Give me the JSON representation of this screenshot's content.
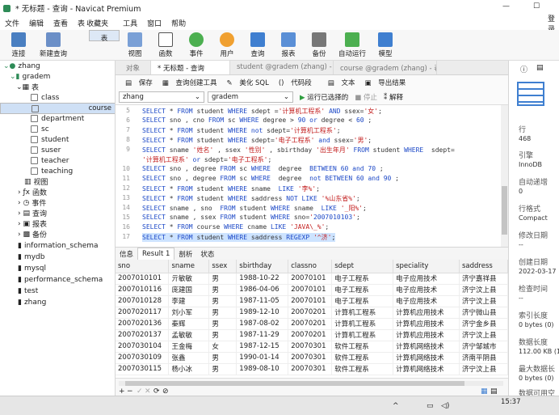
{
  "window": {
    "title": "* 无标题 - 查询 - Navicat Premium",
    "minimize": "—",
    "maximize": "☐"
  },
  "menu": {
    "items": [
      "文件",
      "编辑",
      "查看",
      "表",
      "收藏夹",
      "工具",
      "窗口",
      "帮助"
    ],
    "login": "登录"
  },
  "toolbar": {
    "items": [
      "连接",
      "新建查询",
      "表",
      "视图",
      "函数",
      "事件",
      "用户",
      "查询",
      "报表",
      "备份",
      "自动运行",
      "模型"
    ],
    "selected": "表"
  },
  "tree": {
    "connection": "zhang",
    "db": "gradem",
    "tables_group": "表",
    "tables": [
      "class",
      "course",
      "department",
      "sc",
      "student",
      "suser",
      "teacher",
      "teaching"
    ],
    "selected_table": "course",
    "groups": [
      "视图",
      "函数",
      "事件",
      "查询",
      "报表",
      "备份"
    ],
    "other_dbs": [
      "information_schema",
      "mydb",
      "mysql",
      "performance_schema",
      "test",
      "zhang"
    ]
  },
  "tabs": {
    "objects": "对象",
    "query": "* 无标题 - 查询",
    "t1": "student @gradem (zhang) - ...",
    "t2": "course @gradem (zhang) - 表"
  },
  "qtool": {
    "save": "保存",
    "builder": "查询创建工具",
    "beautify": "美化 SQL",
    "snippet": "代码段",
    "text": "文本",
    "export": "导出结果"
  },
  "selectors": {
    "conn": "zhang",
    "db": "gradem",
    "run": "运行已选择的",
    "stop": "停止",
    "explain": "解释"
  },
  "editor": {
    "lines": [
      {
        "n": "5",
        "t": "SELECT * FROM student WHERE sdept ='计算机工程系' AND ssex='女';"
      },
      {
        "n": "6",
        "t": "SELECT sno , cno FROM sc WHERE degree > 90 or degree < 60 ;"
      },
      {
        "n": "7",
        "t": "SELECT * FROM student WHERE not sdept='计算机工程系';"
      },
      {
        "n": "8",
        "t": "SELECT * FROM student WHERE sdept='电子工程系' and ssex='男';"
      },
      {
        "n": "9",
        "t": "SELECT sname '姓名' , ssex '性别' , sbirthday '出生年月' FROM student WHERE  sdept="
      },
      {
        "n": "",
        "t": "'计算机工程系' or sdept='电子工程系';"
      },
      {
        "n": "10",
        "t": "SELECT sno , degree FROM sc WHERE  degree  BETWEEN 60 and 70 ;"
      },
      {
        "n": "11",
        "t": "SELECT sno , degree FROM sc WHERE  degree  not BETWEEN 60 and 90 ;"
      },
      {
        "n": "12",
        "t": "SELECT * FROM student WHERE sname  LIKE '李%';"
      },
      {
        "n": "13",
        "t": "SELECT * FROM student WHERE saddress NOT LIKE '%山东省%';"
      },
      {
        "n": "14",
        "t": "SELECT sname , sno  FROM student WHERE sname  LIKE '_阳%';"
      },
      {
        "n": "15",
        "t": "SELECT sname , ssex FROM student WHERE sno='2007010103';"
      },
      {
        "n": "16",
        "t": "SELECT * FROM course WHERE cname LIKE 'JAVA\\_%';"
      },
      {
        "n": "17",
        "t": "SELECT * FROM student WHERE saddress REGEXP '^济';"
      }
    ]
  },
  "result_tabs": [
    "信息",
    "Result 1",
    "剖析",
    "状态"
  ],
  "result": {
    "columns": [
      "sno",
      "sname",
      "ssex",
      "sbirthday",
      "classno",
      "sdept",
      "speciality",
      "saddress"
    ],
    "rows": [
      [
        "2007010101",
        "亓敏敏",
        "男",
        "1988-10-22",
        "20070101",
        "电子工程系",
        "电子应用技术",
        "济宁嘉祥县"
      ],
      [
        "2007010116",
        "庞建国",
        "男",
        "1986-04-06",
        "20070101",
        "电子工程系",
        "电子应用技术",
        "济宁汶上县"
      ],
      [
        "2007010128",
        "李建",
        "男",
        "1987-11-05",
        "20070101",
        "电子工程系",
        "电子应用技术",
        "济宁汶上县"
      ],
      [
        "2007020117",
        "刘小军",
        "男",
        "1989-12-10",
        "20070201",
        "计算机工程系",
        "计算机应用技术",
        "济宁微山县"
      ],
      [
        "2007020136",
        "秦辉",
        "男",
        "1987-08-02",
        "20070201",
        "计算机工程系",
        "计算机应用技术",
        "济宁金乡县"
      ],
      [
        "2007020137",
        "孟敏敏",
        "男",
        "1987-11-29",
        "20070201",
        "计算机工程系",
        "计算机应用技术",
        "济宁汶上县"
      ],
      [
        "2007030104",
        "王金梅",
        "女",
        "1987-12-15",
        "20070301",
        "软件工程系",
        "计算机网络技术",
        "济宁邹城市"
      ],
      [
        "2007030109",
        "张鑫",
        "男",
        "1990-01-14",
        "20070301",
        "软件工程系",
        "计算机网络技术",
        "济南平阴县"
      ],
      [
        "2007030115",
        "杨小冰",
        "男",
        "1989-08-10",
        "20070301",
        "软件工程系",
        "计算机网络技术",
        "济宁汶上县"
      ]
    ]
  },
  "info_panel": {
    "rows_label": "行",
    "rows_value": "468",
    "engine_label": "引擎",
    "engine_value": "InnoDB",
    "autoinc_label": "自动递增",
    "autoinc_value": "0",
    "format_label": "行格式",
    "format_value": "Compact",
    "modified_label": "修改日期",
    "modified_value": "--",
    "created_label": "创建日期",
    "created_value": "2022-03-17",
    "checked_label": "检查时间",
    "checked_value": "--",
    "idx_label": "索引长度",
    "idx_value": "0 bytes (0)",
    "data_label": "数据长度",
    "data_value": "112.00 KB (1",
    "maxdata_label": "最大数据长",
    "maxdata_value": "0 bytes (0)",
    "free_label": "数据可用空"
  },
  "taskbar": {
    "time": "15:37"
  }
}
